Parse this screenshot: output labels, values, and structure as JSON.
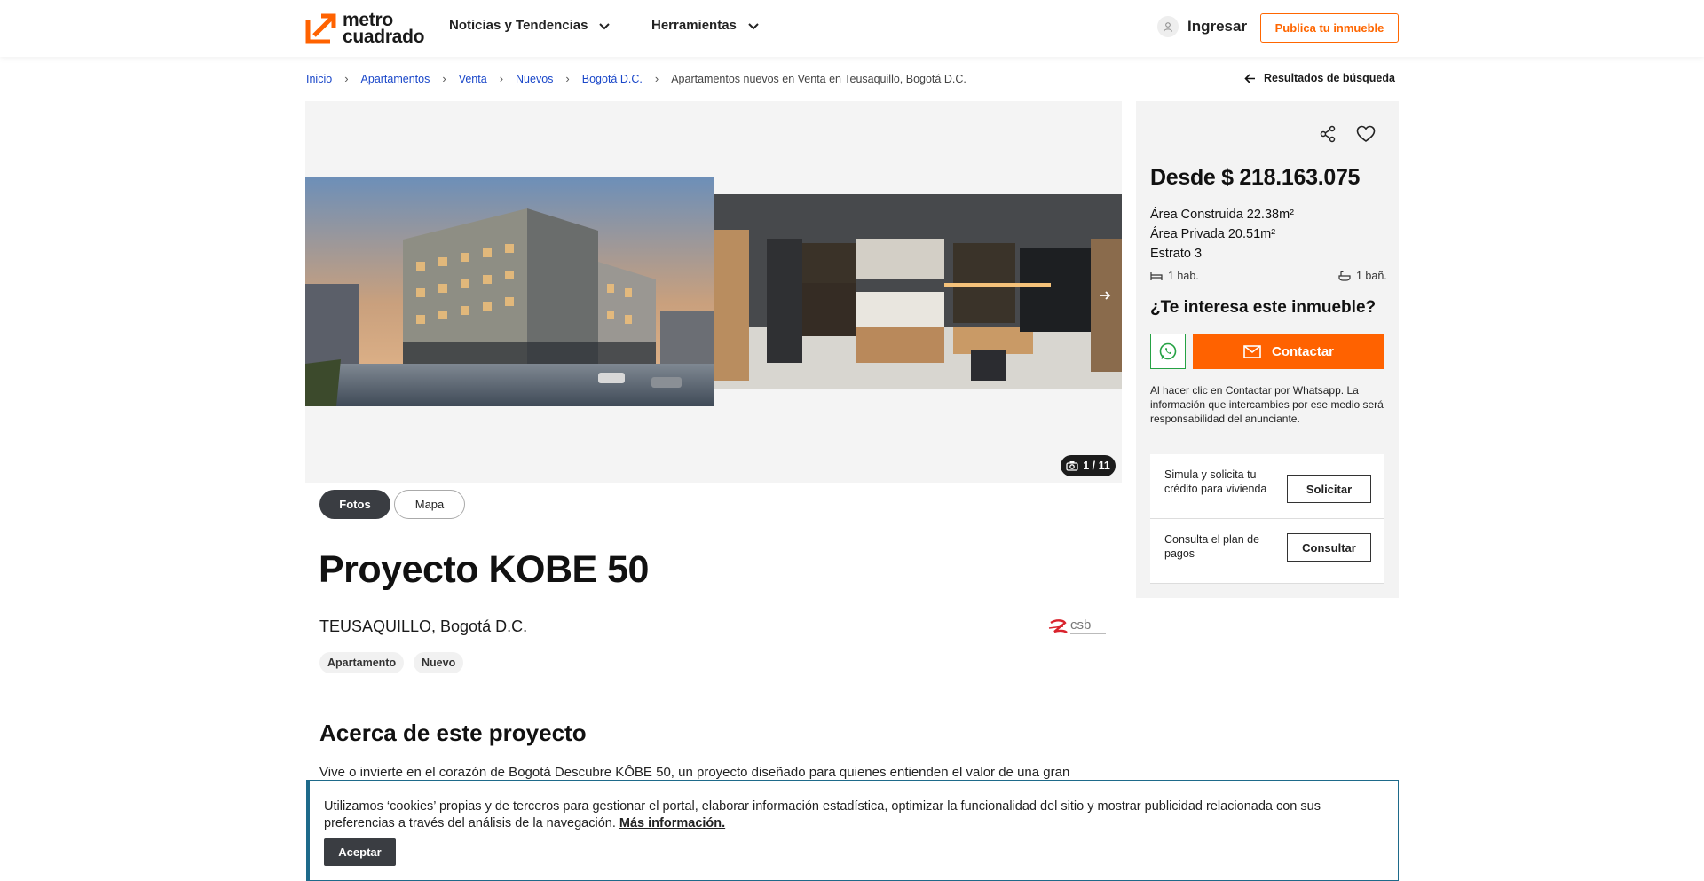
{
  "header": {
    "logo_line1": "metro",
    "logo_line2": "cuadrado",
    "nav": [
      {
        "label": "Noticias y Tendencias"
      },
      {
        "label": "Herramientas"
      }
    ],
    "login_label": "Ingresar",
    "publish_label": "Publica tu inmueble"
  },
  "breadcrumb": {
    "items": [
      "Inicio",
      "Apartamentos",
      "Venta",
      "Nuevos",
      "Bogotá D.C."
    ],
    "current": "Apartamentos nuevos en Venta en Teusaquillo, Bogotá D.C.",
    "back_label": "Resultados de búsqueda"
  },
  "gallery": {
    "counter": "1 / 11",
    "tabs": [
      "Fotos",
      "Mapa"
    ]
  },
  "project": {
    "title": "Proyecto KOBE 50",
    "location": "TEUSAQUILLO, Bogotá D.C.",
    "tags": [
      "Apartamento",
      "Nuevo"
    ],
    "about_title": "Acerca de este proyecto",
    "about_text": "Vive o invierte en el corazón de Bogotá Descubre KÔBE 50, un proyecto diseñado para quienes entienden el valor de una gran"
  },
  "sidebar": {
    "price": "Desde $ 218.163.075",
    "area_built": "Área Construida 22.38m²",
    "area_private": "Área Privada 20.51m²",
    "estrato": "Estrato 3",
    "rooms": "1 hab.",
    "baths": "1 bañ.",
    "interest_title": "¿Te interesa este inmueble?",
    "contact_label": "Contactar",
    "disclaimer": "Al hacer clic en Contactar por Whatsapp. La información que intercambies por ese medio será responsabilidad del anunciante.",
    "credit": [
      {
        "label": "Simula y solicita tu crédito para vivienda",
        "button": "Solicitar"
      },
      {
        "label": "Consulta el plan de pagos",
        "button": "Consultar"
      }
    ]
  },
  "cookie": {
    "text": "Utilizamos ‘cookies’ propias y de terceros para gestionar el portal, elaborar información estadística, optimizar la funcionalidad del sitio y mostrar publicidad relacionada con sus preferencias a través del análisis de la navegación.",
    "more": "Más información.",
    "accept": "Aceptar"
  },
  "colors": {
    "brand_orange": "#ff6200",
    "link_blue": "#1a47c9",
    "whatsapp_green": "#25a244",
    "dark_pill": "#3a3d42"
  }
}
